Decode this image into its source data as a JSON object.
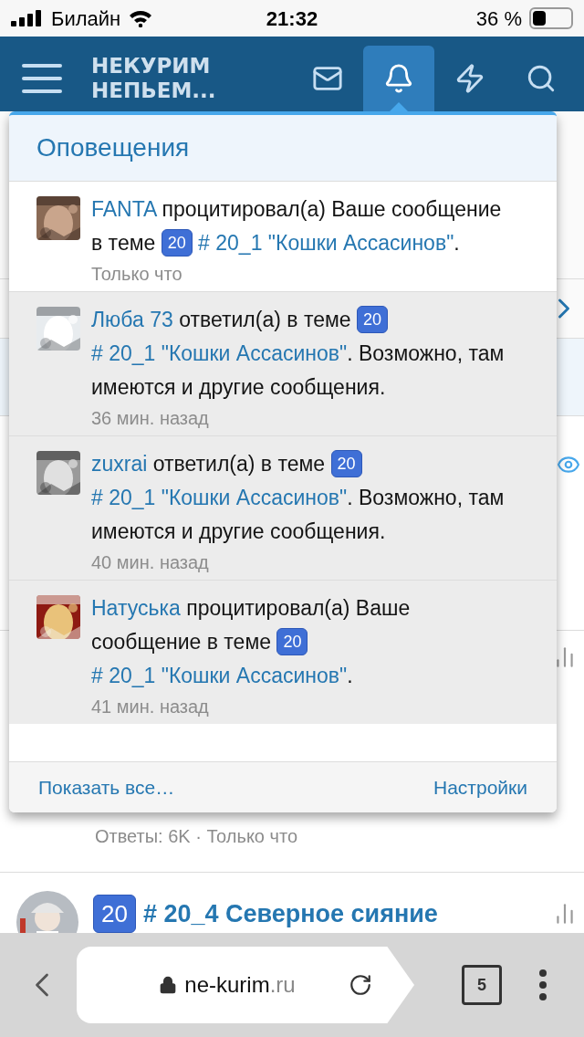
{
  "status_bar": {
    "carrier": "Билайн",
    "time": "21:32",
    "battery": "36 %"
  },
  "header": {
    "logo_lines": [
      "НЕКУРИМ",
      "НЕПЬЕМ..."
    ],
    "nav": [
      {
        "kind": "mail",
        "selected": false
      },
      {
        "kind": "bell",
        "selected": true
      },
      {
        "kind": "bolt",
        "selected": false
      },
      {
        "kind": "search",
        "selected": false
      }
    ]
  },
  "alerts": {
    "title": "Оповещения",
    "items": [
      {
        "user": "FANTA",
        "action": "процитировал(а) Ваше сообщение в теме",
        "badge": "20",
        "thread": "# 20_1 \"Кошки Ассасинов\"",
        "suffix": ".",
        "time": "Только что",
        "highlighted": true
      },
      {
        "user": "Люба 73",
        "action": "ответил(а) в теме",
        "badge": "20",
        "thread": "# 20_1 \"Кошки Ассасинов\"",
        "suffix": ". Возможно, там имеются и другие сообщения.",
        "time": "36 мин. назад",
        "highlighted": false
      },
      {
        "user": "zuxrai",
        "action": "ответил(а) в теме",
        "badge": "20",
        "thread": "# 20_1 \"Кошки Ассасинов\"",
        "suffix": ". Возможно, там имеются и другие сообщения.",
        "time": "40 мин. назад",
        "highlighted": false
      },
      {
        "user": "Натуська",
        "action": "процитировал(а) Ваше сообщение в теме",
        "badge": "20",
        "thread": "# 20_1 \"Кошки Ассасинов\"",
        "suffix": ".",
        "time": "41 мин. назад",
        "highlighted": false
      }
    ],
    "show_all": "Показать все…",
    "settings": "Настройки"
  },
  "page": {
    "thread_meta": "Ответы: 6K · Только что",
    "next_thread": {
      "badge": "20",
      "title": "# 20_4 Северное сияние"
    }
  },
  "browser": {
    "host": "ne-kurim",
    "tld": ".ru",
    "tabs": "5"
  }
}
